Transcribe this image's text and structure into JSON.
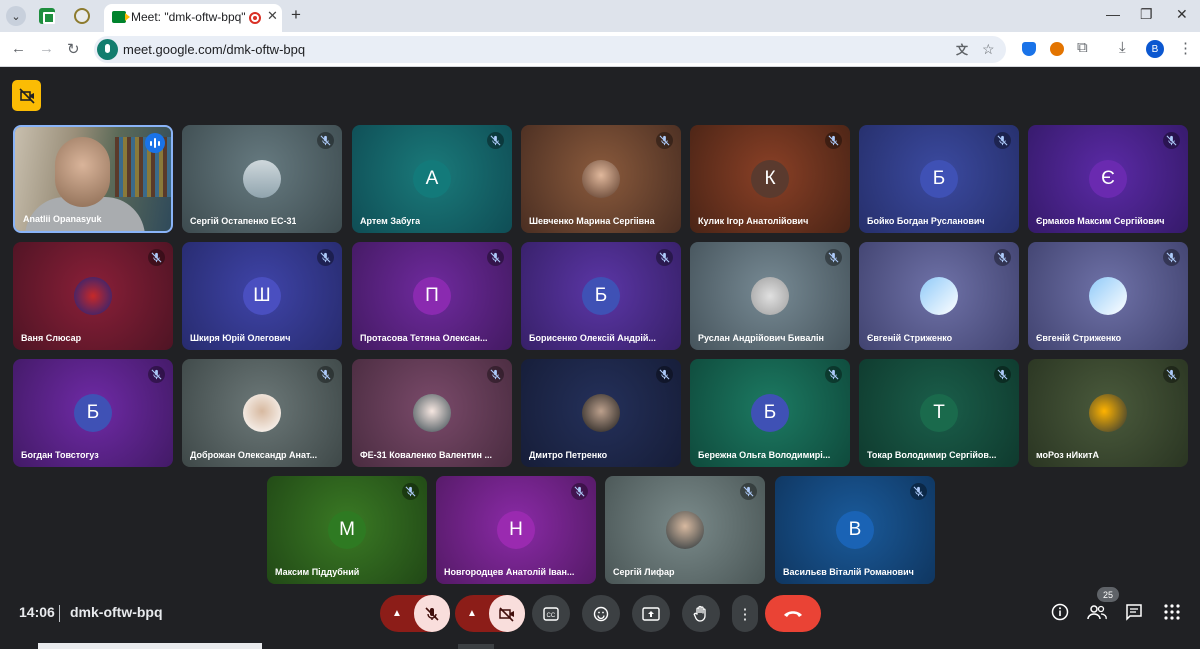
{
  "browser": {
    "tab_title": "Meet: \"dmk-oftw-bpq\"",
    "url": "meet.google.com/dmk-oftw-bpq",
    "profile_initial": "B"
  },
  "meeting": {
    "time": "14:06",
    "code": "dmk-oftw-bpq",
    "participant_count": "25"
  },
  "tiles": [
    {
      "name": "Anatlii Opanasyuk",
      "initial": "",
      "photo": "person",
      "speaking": true
    },
    {
      "name": "Сергій Остапенко ЕС-31",
      "initial": "",
      "photo": "landscape"
    },
    {
      "name": "Артем Забуга",
      "initial": "А"
    },
    {
      "name": "Шевченко Марина Сергіівна",
      "initial": "",
      "photo": "woman"
    },
    {
      "name": "Кулик Ігор Анатолійович",
      "initial": "К"
    },
    {
      "name": "Бойко Богдан Русланович",
      "initial": "Б"
    },
    {
      "name": "Єрмаков Максим Сергійович",
      "initial": "Є"
    },
    {
      "name": "Ваня Слюсар",
      "initial": "",
      "photo": "spider"
    },
    {
      "name": "Шкиря Юрій Олегович",
      "initial": "Ш"
    },
    {
      "name": "Протасова Тетяна Олексан...",
      "initial": "П"
    },
    {
      "name": "Борисенко Олексій Андрій...",
      "initial": "Б"
    },
    {
      "name": "Руслан Андрійович Бивалін",
      "initial": "",
      "photo": "cat"
    },
    {
      "name": "Євгеній Стриженко",
      "initial": "",
      "photo": "sticker"
    },
    {
      "name": "Євгеній Стриженко",
      "initial": "",
      "photo": "sticker"
    },
    {
      "name": "Богдан Товстогуз",
      "initial": "Б"
    },
    {
      "name": "Доброжан Олександр Анат...",
      "initial": "",
      "photo": "man"
    },
    {
      "name": "ФЕ-31 Коваленко Валентин ...",
      "initial": "",
      "photo": "anime"
    },
    {
      "name": "Дмитро Петренко",
      "initial": "",
      "photo": "dark"
    },
    {
      "name": "Бережна Ольга Володимирі...",
      "initial": "Б"
    },
    {
      "name": "Токар Володимир Сергійов...",
      "initial": "Т"
    },
    {
      "name": "моРоз нИкитА",
      "initial": "",
      "photo": "bird"
    },
    {
      "name": "Максим Піддубний",
      "initial": "М"
    },
    {
      "name": "Новгородцев Анатолій Іван...",
      "initial": "Н"
    },
    {
      "name": "Сергій Лифар",
      "initial": "",
      "photo": "suit"
    },
    {
      "name": "Васильєв Віталій Романович",
      "initial": "В"
    }
  ]
}
